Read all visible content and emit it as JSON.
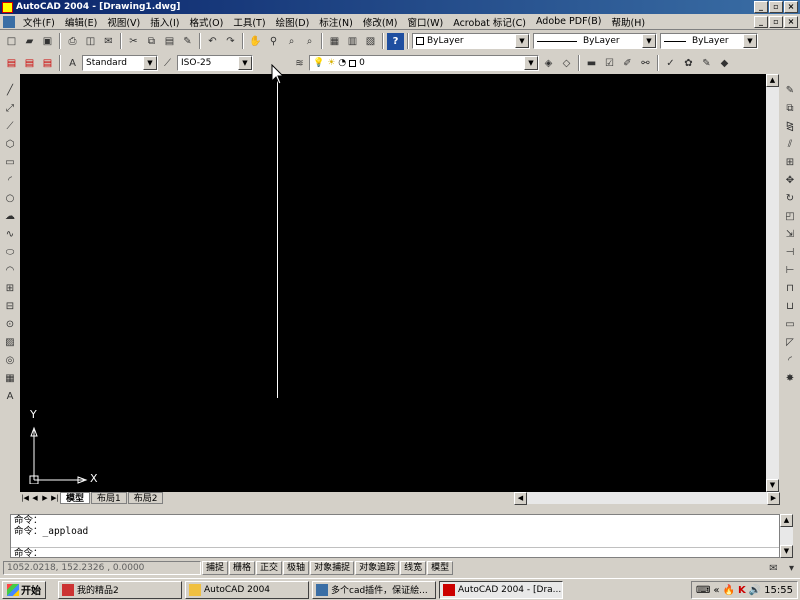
{
  "window": {
    "title": "AutoCAD 2004 - [Drawing1.dwg]",
    "min": "_",
    "max": "▫",
    "close": "×"
  },
  "menu": {
    "items": [
      "文件(F)",
      "编辑(E)",
      "视图(V)",
      "插入(I)",
      "格式(O)",
      "工具(T)",
      "绘图(D)",
      "标注(N)",
      "修改(M)",
      "窗口(W)",
      "Acrobat 标记(C)",
      "Adobe PDF(B)",
      "帮助(H)"
    ]
  },
  "properties": {
    "layer_color": "ByLayer",
    "linetype": "ByLayer",
    "lineweight": "ByLayer"
  },
  "styles": {
    "text_style": "Standard",
    "dim_style": "ISO-25"
  },
  "layer": {
    "current": "0"
  },
  "ucs": {
    "y": "Y",
    "x": "X"
  },
  "layout_tabs": [
    "模型",
    "布局1",
    "布局2"
  ],
  "command": {
    "lines": [
      "命令：",
      "命令：_appload",
      "命令："
    ]
  },
  "status": {
    "coords": "1052.0218, 152.2326 , 0.0000",
    "buttons": [
      "捕捉",
      "栅格",
      "正交",
      "极轴",
      "对象捕捉",
      "对象追踪",
      "线宽",
      "模型"
    ]
  },
  "taskbar": {
    "start": "开始",
    "tasks": [
      "我的精品2",
      "AutoCAD 2004",
      "多个cad插件，保证絵...",
      "AutoCAD 2004 - [Dra..."
    ],
    "clock": "15:55"
  },
  "colors": {
    "title_start": "#0a246a",
    "title_end": "#3a6ea5",
    "canvas": "#000000"
  }
}
